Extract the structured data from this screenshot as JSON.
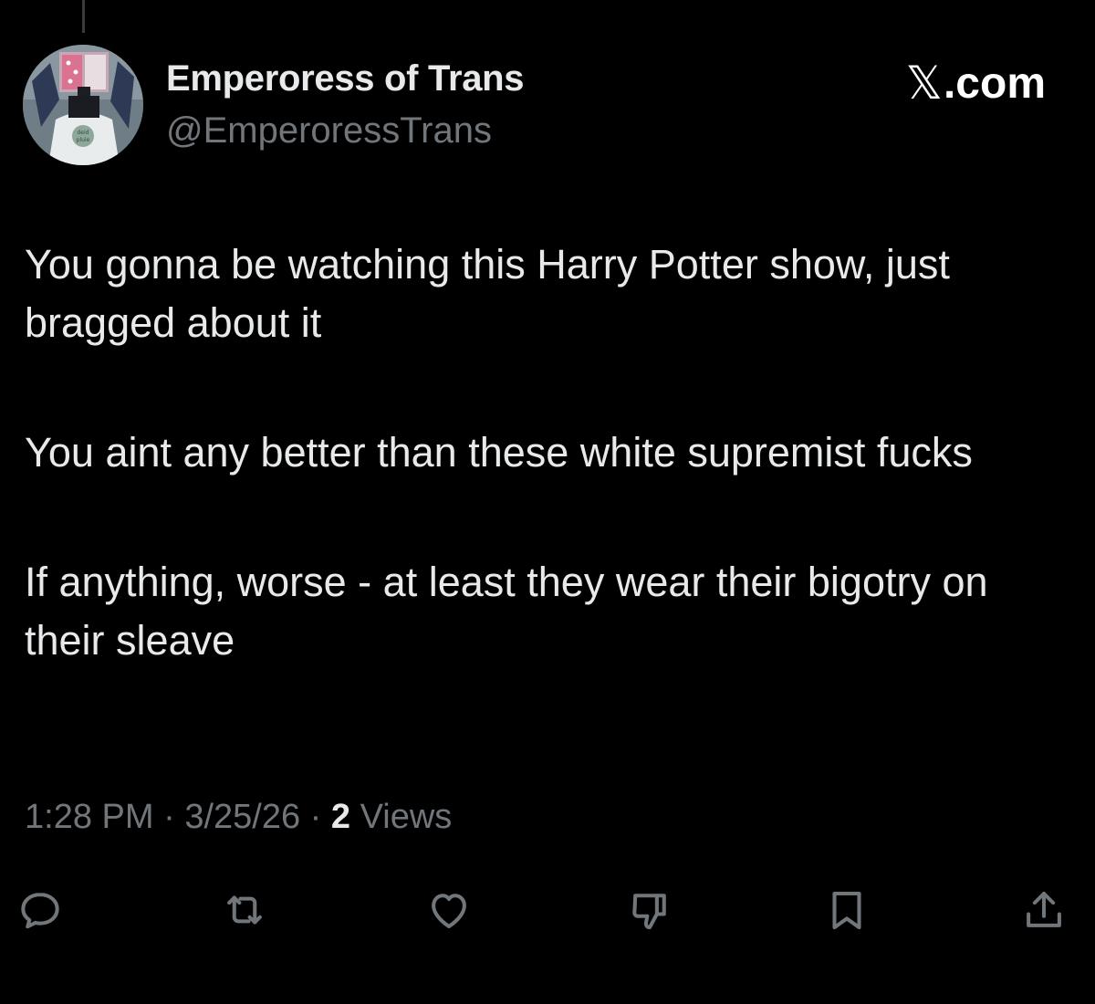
{
  "author": {
    "display_name": "Emperoress of Trans",
    "handle": "@EmperoressTrans",
    "avatar_icon": "avatar-anime-character"
  },
  "branding": {
    "logo_mark": "𝕏",
    "logo_text": ".com"
  },
  "tweet": {
    "paragraphs": [
      "You gonna be watching this Harry Potter show, just bragged about it",
      "You aint any better than these white supremist fucks",
      "If anything, worse - at least they wear their bigotry on their sleave"
    ]
  },
  "meta": {
    "time": "1:28 PM",
    "separator": " · ",
    "date": "3/25/26",
    "views_count": "2",
    "views_label": " Views"
  },
  "actions": [
    {
      "name": "reply",
      "icon": "reply-icon"
    },
    {
      "name": "retweet",
      "icon": "retweet-icon"
    },
    {
      "name": "like",
      "icon": "heart-icon"
    },
    {
      "name": "downvote",
      "icon": "thumbs-down-icon"
    },
    {
      "name": "bookmark",
      "icon": "bookmark-icon"
    },
    {
      "name": "share",
      "icon": "share-icon"
    }
  ],
  "colors": {
    "background": "#000000",
    "primary_text": "#e7e9ea",
    "secondary_text": "#71767b",
    "icon": "#71767b"
  }
}
